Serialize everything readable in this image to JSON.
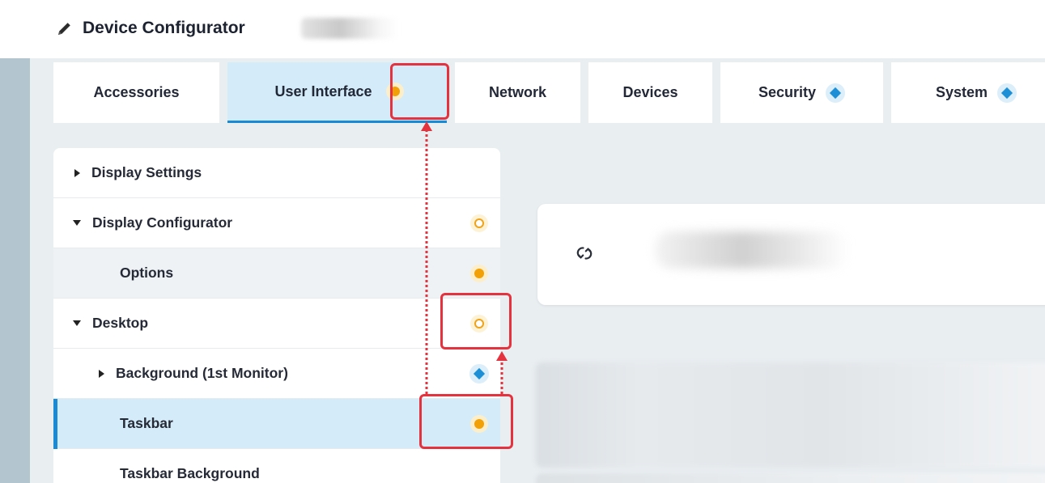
{
  "header": {
    "title": "Device Configurator",
    "edit_icon": "pencil-icon"
  },
  "tabs": [
    {
      "label": "Accessories",
      "status": "none",
      "active": false
    },
    {
      "label": "User Interface",
      "status": "modified",
      "active": true
    },
    {
      "label": "Network",
      "status": "none",
      "active": false
    },
    {
      "label": "Devices",
      "status": "none",
      "active": false
    },
    {
      "label": "Security",
      "status": "diamond",
      "active": false
    },
    {
      "label": "System",
      "status": "diamond",
      "active": false
    }
  ],
  "tree": {
    "items": [
      {
        "label": "Display Settings",
        "expander": "collapsed",
        "level": 0,
        "status": "none"
      },
      {
        "label": "Display Configurator",
        "expander": "expanded",
        "level": 0,
        "status": "partially-modified"
      },
      {
        "label": "Options",
        "expander": "none",
        "level": 1,
        "status": "modified"
      },
      {
        "label": "Desktop",
        "expander": "expanded",
        "level": 0,
        "status": "partially-modified"
      },
      {
        "label": "Background (1st Monitor)",
        "expander": "collapsed",
        "level": 1,
        "status": "diamond"
      },
      {
        "label": "Taskbar",
        "expander": "none",
        "level": 1,
        "status": "modified",
        "selected": true
      },
      {
        "label": "Taskbar Background",
        "expander": "none",
        "level": 1,
        "status": "none"
      }
    ]
  },
  "card": {
    "icon": "sync-icon"
  },
  "colors": {
    "accent": "#1a8ad4",
    "status_modified": "#f2a008",
    "status_diamond": "#1d8fd6",
    "highlight": "#e4333f"
  }
}
